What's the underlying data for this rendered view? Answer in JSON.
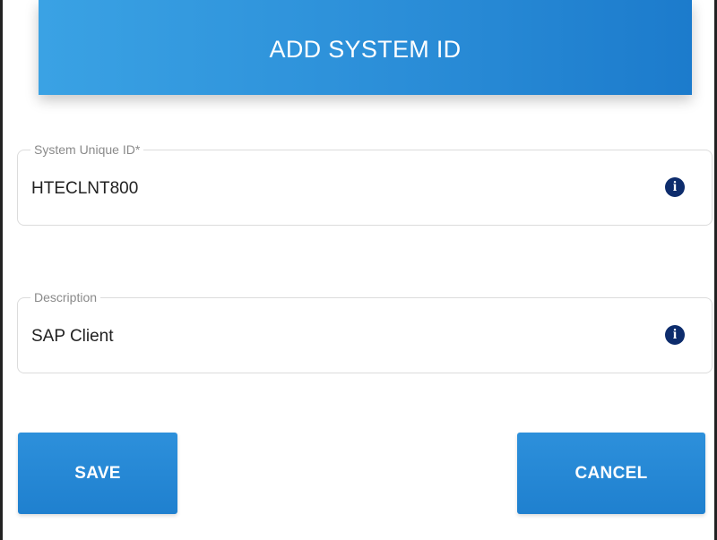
{
  "dialog": {
    "title": "ADD SYSTEM ID"
  },
  "fields": {
    "system_id": {
      "label": "System Unique ID*",
      "value": "HTECLNT800"
    },
    "description": {
      "label": "Description",
      "value": "SAP Client"
    }
  },
  "icons": {
    "info": "info-icon",
    "info_glyph": "i"
  },
  "buttons": {
    "save": "SAVE",
    "cancel": "CANCEL"
  },
  "colors": {
    "primary": "#2b8ed8",
    "info_icon": "#0d2c6c",
    "field_border": "#dcdcdc",
    "label_text": "#8a8a8a"
  }
}
